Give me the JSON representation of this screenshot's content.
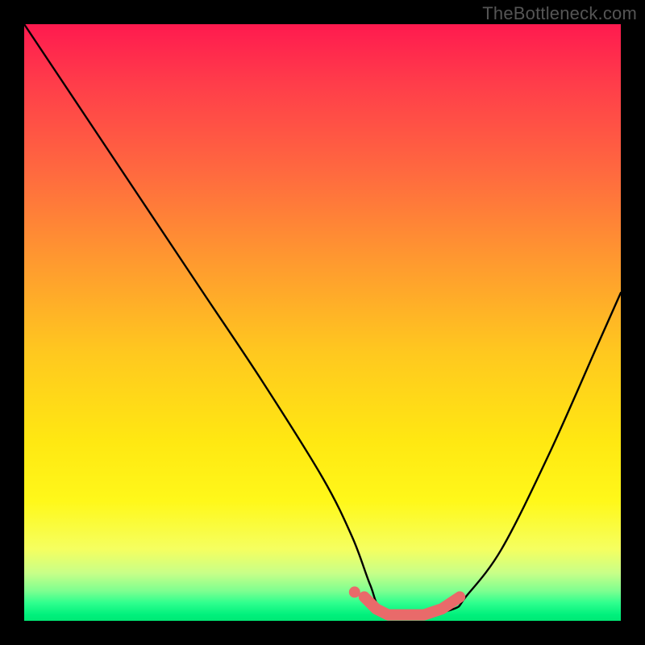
{
  "branding": {
    "watermark": "TheBottleneck.com"
  },
  "chart_data": {
    "type": "line",
    "title": "",
    "xlabel": "",
    "ylabel": "",
    "xlim": [
      0,
      100
    ],
    "ylim": [
      0,
      100
    ],
    "series": [
      {
        "name": "bottleneck-curve",
        "x": [
          0,
          10,
          20,
          30,
          40,
          50,
          55,
          58,
          60,
          66,
          72,
          74,
          80,
          88,
          96,
          100
        ],
        "values": [
          100,
          85,
          70,
          55,
          40,
          24,
          14,
          6,
          2,
          1,
          2,
          4,
          12,
          28,
          46,
          55
        ]
      }
    ],
    "markers": {
      "name": "recommended-range",
      "color": "#e96a6a",
      "x": [
        57,
        59,
        61,
        63,
        65,
        67,
        70,
        73
      ],
      "y": [
        4,
        2,
        1,
        1,
        1,
        1,
        2,
        4
      ]
    },
    "background_gradient": {
      "top": "#ff1a4f",
      "mid": "#ffe812",
      "bottom": "#00e874"
    }
  }
}
